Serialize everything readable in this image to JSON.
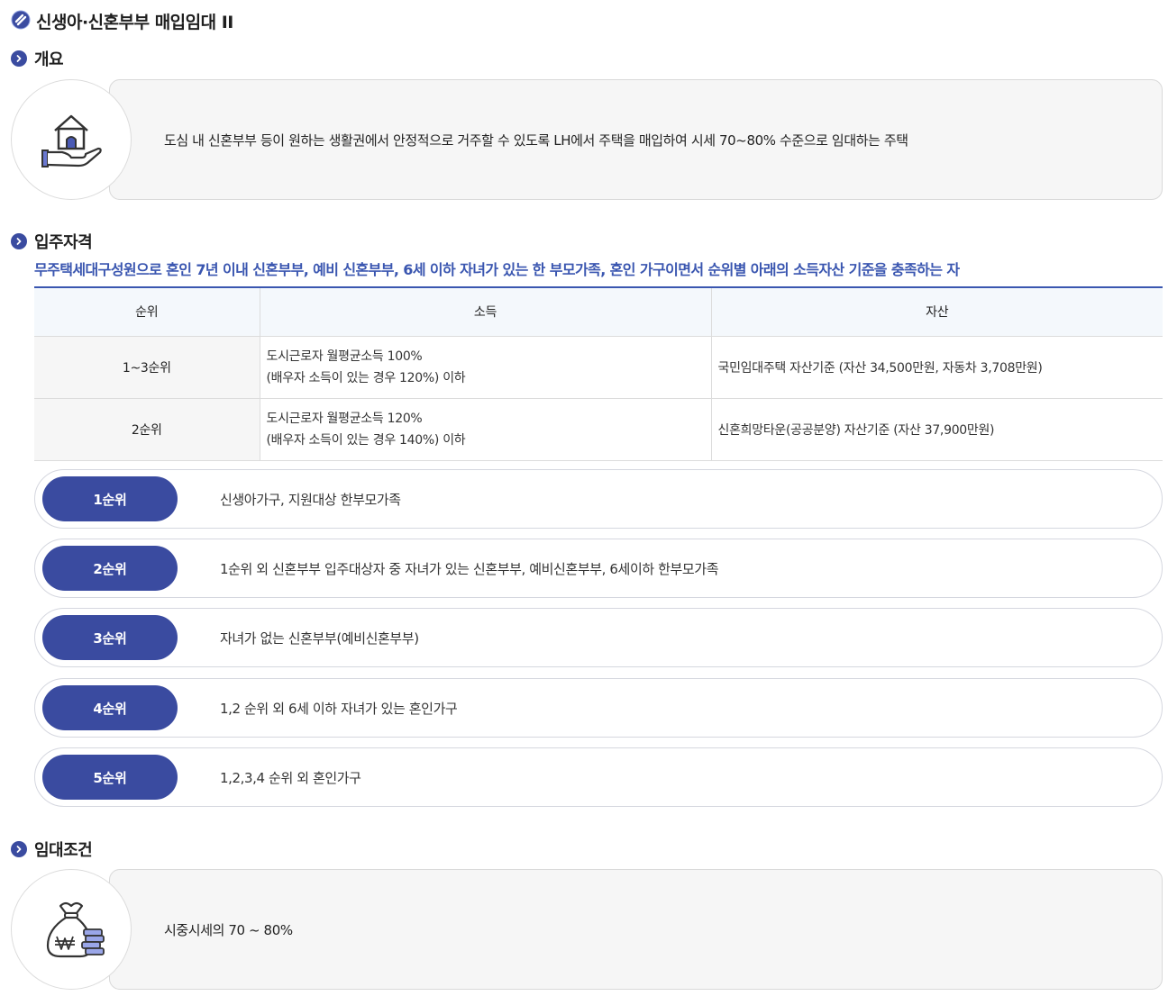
{
  "page": {
    "title": "신생아·신혼부부 매입임대 II"
  },
  "overview": {
    "heading": "개요",
    "icon": "house-in-hand-icon",
    "text": "도심 내 신혼부부 등이 원하는 생활권에서 안정적으로 거주할 수 있도록 LH에서 주택을 매입하여 시세 70~80% 수준으로 임대하는 주택"
  },
  "eligibility": {
    "heading": "입주자격",
    "subtitle": "무주택세대구성원으로 혼인 7년 이내 신혼부부, 예비 신혼부부, 6세 이하 자녀가 있는 한 부모가족, 혼인 가구이면서 순위별 아래의 소득자산 기준을 충족하는 자",
    "table": {
      "headers": [
        "순위",
        "소득",
        "자산"
      ],
      "rows": [
        {
          "rank": "1~3순위",
          "income_line1": "도시근로자 월평균소득 100%",
          "income_line2": "(배우자 소득이 있는 경우 120%) 이하",
          "asset": "국민임대주택 자산기준 (자산 34,500만원, 자동차 3,708만원)"
        },
        {
          "rank": "2순위",
          "income_line1": "도시근로자 월평균소득 120%",
          "income_line2": "(배우자 소득이 있는 경우 140%) 이하",
          "asset": "신혼희망타운(공공분양) 자산기준 (자산 37,900만원)"
        }
      ]
    },
    "ranks": [
      {
        "label": "1순위",
        "text": "신생아가구, 지원대상 한부모가족"
      },
      {
        "label": "2순위",
        "text": "1순위 외 신혼부부 입주대상자 중 자녀가 있는 신혼부부, 예비신혼부부, 6세이하 한부모가족"
      },
      {
        "label": "3순위",
        "text": "자녀가 없는 신혼부부(예비신혼부부)"
      },
      {
        "label": "4순위",
        "text": "1,2 순위 외 6세 이하 자녀가 있는 혼인가구"
      },
      {
        "label": "5순위",
        "text": "1,2,3,4 순위 외 혼인가구"
      }
    ]
  },
  "rent": {
    "heading": "임대조건",
    "icon": "money-bag-coins-icon",
    "text": "시중시세의 70 ~ 80%"
  },
  "colors": {
    "accent": "#3a4ba0",
    "subtitle": "#3a56b0",
    "box_bg": "#f6f6f6",
    "header_bg": "#f4f8fc"
  }
}
